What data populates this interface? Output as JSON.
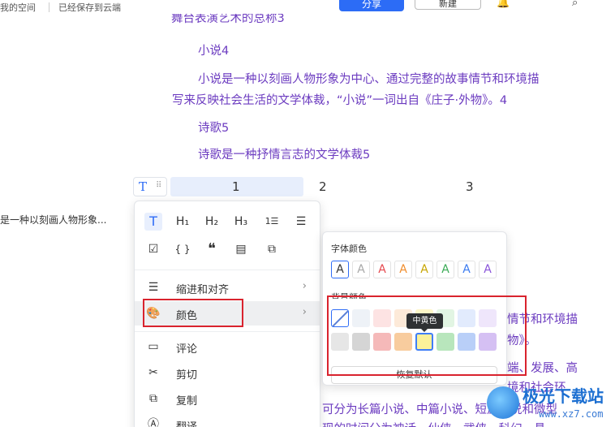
{
  "topbar": {
    "space_label": "我的空间",
    "save_status": "已经保存到云端",
    "share_label": "分享",
    "new_label": "新建",
    "bell_icon": "bell-icon",
    "search_icon": "search-icon"
  },
  "document": {
    "cut_line": "舞台表演艺术的总称3",
    "heading_novel": "小说4",
    "novel_line1": "小说是一种以刻画人物形象为中心、通过完整的故事情节和环境描",
    "novel_line2": "写来反映社会生活的文学体裁，“小说”一词出自《庄子·外物》。4",
    "heading_poetry": "诗歌5",
    "poetry_line": "诗歌是一种抒情言志的文学体裁5",
    "left_snippet": "是一种以刻画人物形象...",
    "right_line1": "情节和环境描",
    "right_line2": "物》。",
    "right_line3": "端、发展、高",
    "right_line4": "境和社会环",
    "bottom_line1": "可分为长篇小说、中篇小说、短篇小说和微型",
    "bottom_line2": "现的时间分为神话、仙侠、武侠、科幻、悬"
  },
  "table_header": {
    "handle_icon": "T",
    "col1": "1",
    "col2": "2",
    "col3": "3"
  },
  "format_icons": {
    "text": "T",
    "h1": "H₁",
    "h2": "H₂",
    "h3": "H₃",
    "ordered_list": "1☰",
    "bullet_list": "☰",
    "checkbox": "☑",
    "code": "{ }",
    "quote": "❝",
    "highlight_block": "▤",
    "sync_block": "⧉"
  },
  "menu": {
    "indent_align": "缩进和对齐",
    "color": "颜色",
    "comment": "评论",
    "cut": "剪切",
    "copy": "复制",
    "translate": "翻译"
  },
  "color_panel": {
    "font_color_title": "字体颜色",
    "bg_color_title": "背景颜色",
    "font_letter": "A",
    "font_colors": [
      "#333333",
      "#a8a8a8",
      "#e5484d",
      "#f08c2b",
      "#c7a500",
      "#3aaa55",
      "#3b7bf0",
      "#8a54d9"
    ],
    "bg_row1": [
      "none",
      "#eef2f7",
      "#fde3e3",
      "#fdead9",
      "#fdf6c8",
      "#e2f5e3",
      "#e2ebfd",
      "#efe6fb"
    ],
    "bg_row2": [
      "#e6e6e6",
      "#d5d5d5",
      "#f5b9b9",
      "#f8cc9e",
      "#fbf19a",
      "#b8e6bc",
      "#b9cff8",
      "#d5c0f3"
    ],
    "tooltip": "中黄色",
    "reset_label": "恢复默认"
  },
  "watermark": {
    "text": "极光下载站",
    "url": "www.xz7.com"
  },
  "colors": {
    "accent": "#2f6df6",
    "doc_text": "#6c3cc0",
    "highlight_red": "#d9232e"
  }
}
